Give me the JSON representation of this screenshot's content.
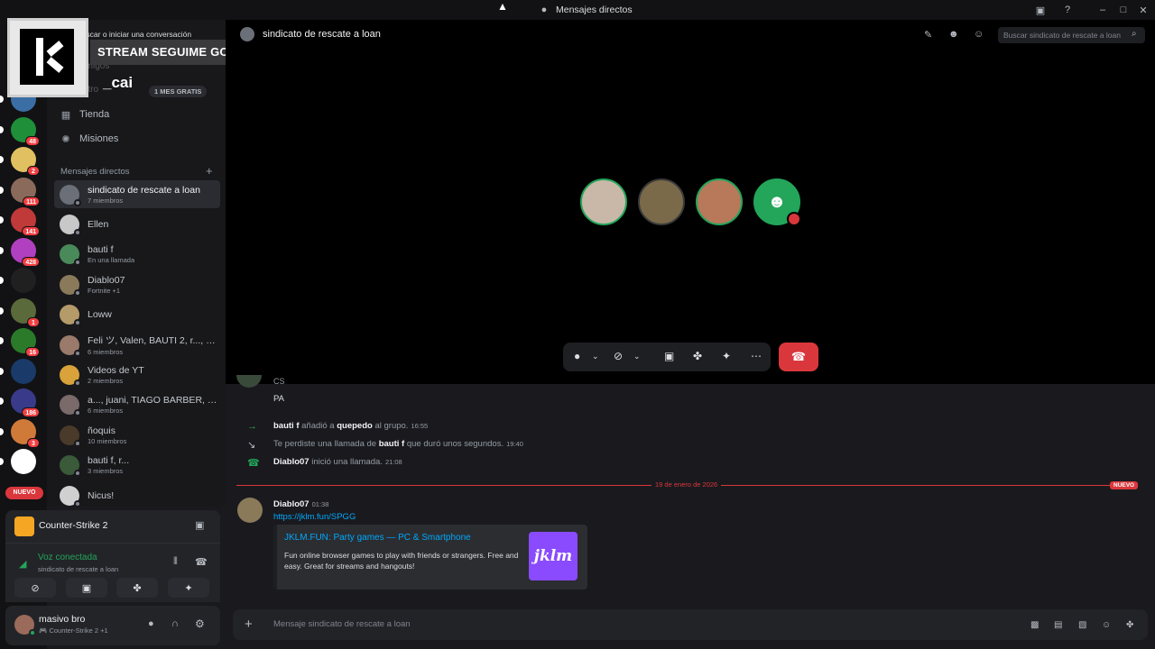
{
  "window": {
    "title": "Mensajes directos"
  },
  "overlay": {
    "banner": "STREAM SEGUIME GORDOO",
    "name": "cai"
  },
  "sidebar": {
    "search_placeholder": "Buscar o iniciar una conversación",
    "friends_label": "Amigos",
    "nitro_label": "Nitro",
    "nitro_badge": "1 MES GRATIS",
    "shop_label": "Tienda",
    "missions_label": "Misiones",
    "dm_header": "Mensajes directos",
    "dms": [
      {
        "name": "sindicato de rescate a loan",
        "sub": "7 miembros",
        "selected": true,
        "color": "#6b6f78"
      },
      {
        "name": "Ellen",
        "sub": "",
        "color": "#c8c8c8"
      },
      {
        "name": "bauti f",
        "sub": "En una llamada",
        "color": "#4a8a5a"
      },
      {
        "name": "Diablo07",
        "sub": "Fortnite +1",
        "color": "#8a7a5a"
      },
      {
        "name": "Loww",
        "sub": "",
        "color": "#b59a6a"
      },
      {
        "name": "Feli ツ, Valen, BAUTI 2, r..., b...",
        "sub": "6 miembros",
        "color": "#9a7a6a"
      },
      {
        "name": "Videos de YT",
        "sub": "2 miembros",
        "color": "#d9a23a"
      },
      {
        "name": "a..., juani, TIAGO BARBER, la...",
        "sub": "6 miembros",
        "color": "#7a6a6a"
      },
      {
        "name": "ñoquis",
        "sub": "10 miembros",
        "color": "#4a3a2a"
      },
      {
        "name": "bauti f, r...",
        "sub": "3 miembros",
        "color": "#3a5a3a"
      },
      {
        "name": "Nicus!",
        "sub": "",
        "color": "#d0d0d0"
      }
    ],
    "servers": [
      {
        "badge": "",
        "color": "#3a6ea5"
      },
      {
        "badge": "48",
        "color": "#1f8f3a"
      },
      {
        "badge": "2",
        "color": "#e0c060"
      },
      {
        "badge": "111",
        "color": "#8a6a5a"
      },
      {
        "badge": "141",
        "color": "#c03a3a"
      },
      {
        "badge": "428",
        "color": "#b040c0"
      },
      {
        "badge": "",
        "color": "#202020"
      },
      {
        "badge": "1",
        "color": "#5a6a3a"
      },
      {
        "badge": "16",
        "color": "#2a7a2a"
      },
      {
        "badge": "",
        "color": "#1a3a6a"
      },
      {
        "badge": "186",
        "color": "#3a3a8a"
      },
      {
        "badge": "3",
        "color": "#d07a3a"
      },
      {
        "badge": "",
        "color": "#ffffff"
      }
    ],
    "new_label": "NUEVO"
  },
  "activity": {
    "game": "Counter-Strike 2"
  },
  "voice": {
    "status": "Voz conectada",
    "channel": "sindicato de rescate a loan"
  },
  "user": {
    "name": "masivo bro",
    "status": "Counter-Strike 2 +1"
  },
  "call": {
    "channel_title": "sindicato de rescate a loan",
    "search_placeholder": "Buscar sindicato de rescate a loan"
  },
  "messages": {
    "prev_tail": [
      "CS",
      "PA"
    ],
    "events": [
      {
        "actor": "bauti f",
        "text1": " añadió a ",
        "target": "quepedo",
        "text2": " al grupo.",
        "time": "16:55"
      },
      {
        "pre": "Te perdiste una llamada de ",
        "actor": "bauti f",
        "post": " que duró unos segundos.",
        "time": "19:40"
      },
      {
        "actor": "Diablo07",
        "text": " inició una llamada.",
        "time": "21:08"
      }
    ],
    "divider_date": "19 de enero de 2026",
    "new_pill": "NUEVO",
    "post": {
      "author": "Diablo07",
      "time": "01:38",
      "link": "https://jklm.fun/SPGG",
      "embed_title": "JKLM.FUN: Party games — PC & Smartphone",
      "embed_desc": "Fun online browser games to play with friends or strangers. Free and easy. Great for streams and hangouts!",
      "embed_thumb": "jklm"
    }
  },
  "composer": {
    "placeholder": "Mensaje sindicato de rescate a loan"
  }
}
